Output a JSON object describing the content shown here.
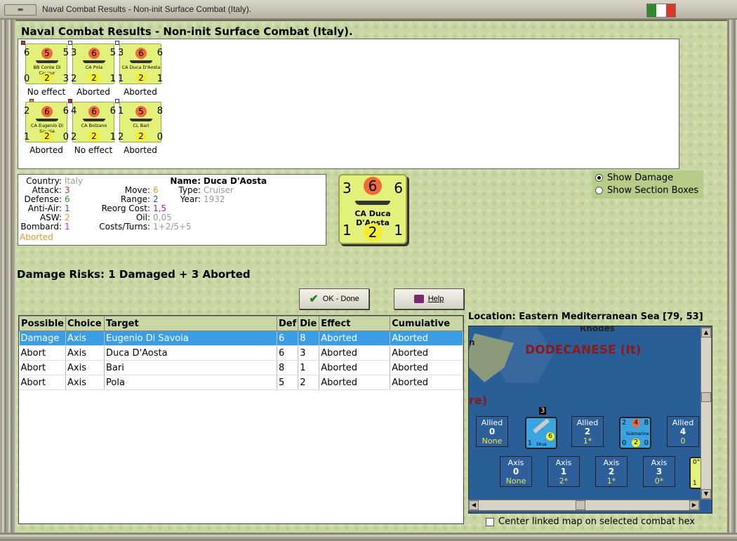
{
  "window": {
    "title": "Naval Combat Results - Non-init Surface Combat (Italy).",
    "sys_label": "▬",
    "flag_colors": [
      "#2e8b2e",
      "#ffffff",
      "#d63a2a"
    ]
  },
  "header": "Naval Combat Results - Non-init Surface Combat (Italy).",
  "units": [
    {
      "tl": "6",
      "tc": "5",
      "tr": "5",
      "name": "BB Conte Di Cavour",
      "bl": "0",
      "bc": "2",
      "br": "3",
      "result": "No effect"
    },
    {
      "tl": "3",
      "tc": "6",
      "tr": "5",
      "name": "CA Pola",
      "bl": "2",
      "bc": "2",
      "br": "1",
      "result": "Aborted"
    },
    {
      "tl": "3",
      "tc": "6",
      "tr": "6",
      "name": "CA Duca D'Aosta",
      "bl": "1",
      "bc": "2",
      "br": "1",
      "result": "Aborted"
    },
    {
      "tl": "2",
      "tc": "6",
      "tr": "6",
      "name": "CA Eugenio Di Savoia",
      "bl": "1",
      "bc": "2",
      "br": "0",
      "result": "Aborted"
    },
    {
      "tl": "4",
      "tc": "6",
      "tr": "6",
      "name": "CA Bolzano",
      "bl": "2",
      "bc": "2",
      "br": "1",
      "result": "No effect"
    },
    {
      "tl": "1",
      "tc": "5",
      "tr": "8",
      "name": "CL Bari",
      "bl": "2",
      "bc": "2",
      "br": "0",
      "result": "Aborted"
    }
  ],
  "info": {
    "country_label": "Country:",
    "country": "Italy",
    "attack_label": "Attack:",
    "attack": "3",
    "defense_label": "Defense:",
    "defense": "6",
    "antiair_label": "Anti-Air:",
    "antiair": "1",
    "asw_label": "ASW:",
    "asw": "2",
    "bombard_label": "Bombard:",
    "bombard": "1",
    "status": "Aborted",
    "move_label": "Move:",
    "move": "6",
    "range_label": "Range:",
    "range": "2",
    "reorg_label": "Reorg Cost:",
    "reorg": "1,5",
    "oil_label": "Oil:",
    "oil": "0,05",
    "costs_label": "Costs/Turns:",
    "costs": "1+2/5+5",
    "name_label": "Name:",
    "name": "Duca D'Aosta",
    "type_label": "Type:",
    "type": "Cruiser",
    "year_label": "Year:",
    "year": "1932"
  },
  "big_counter": {
    "tl": "3",
    "tc": "6",
    "tr": "6",
    "name": "CA Duca D'Aosta",
    "bl": "1",
    "bc": "2",
    "br": "1"
  },
  "options": {
    "show_damage": "Show Damage",
    "show_sections": "Show Section Boxes"
  },
  "risks": "Damage Risks:  1 Damaged + 3 Aborted",
  "buttons": {
    "ok": "OK - Done",
    "help": "Help"
  },
  "grid": {
    "headers": [
      "Possible",
      "Choice",
      "Target",
      "Def",
      "Die",
      "Effect",
      "Cumulative"
    ],
    "rows": [
      [
        "Damage",
        "Axis",
        "Eugenio Di Savoia",
        "6",
        "8",
        "Aborted",
        "Aborted"
      ],
      [
        "Abort",
        "Axis",
        "Duca D'Aosta",
        "6",
        "3",
        "Aborted",
        "Aborted"
      ],
      [
        "Abort",
        "Axis",
        "Bari",
        "8",
        "1",
        "Aborted",
        "Aborted"
      ],
      [
        "Abort",
        "Axis",
        "Pola",
        "5",
        "2",
        "Aborted",
        "Aborted"
      ]
    ]
  },
  "location": "Location:  Eastern Mediterranean Sea [79, 53]",
  "map": {
    "rhodes": "Rhodes",
    "dodecanese": "DODECANESE (It)",
    "re": "re)",
    "n": "n",
    "stack_count": "3",
    "allied": [
      {
        "label": "Allied",
        "num": "0",
        "sub": "None"
      },
      {
        "label": "Allied",
        "num": "2",
        "sub": "1*"
      },
      {
        "label": "Allied",
        "num": "4",
        "sub": "0"
      }
    ],
    "axis": [
      {
        "label": "Axis",
        "num": "0",
        "sub": "None"
      },
      {
        "label": "Axis",
        "num": "1",
        "sub": "2*"
      },
      {
        "label": "Axis",
        "num": "2",
        "sub": "1*"
      },
      {
        "label": "Axis",
        "num": "3",
        "sub": "0*"
      }
    ],
    "skua": {
      "name": "Skua",
      "bl": "1",
      "br": "6"
    },
    "sub": {
      "tl": "2",
      "tc": "4",
      "tr": "8",
      "name": "Submarine",
      "bl": "0",
      "bc": "2",
      "br": "0"
    },
    "edge_counter": {
      "tl": "0°",
      "bl": "1"
    }
  },
  "center_label": "Center linked map on selected combat hex"
}
